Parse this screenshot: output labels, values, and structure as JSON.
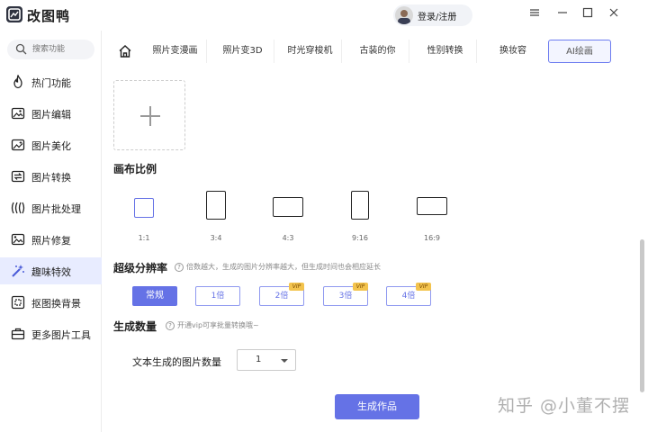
{
  "app": {
    "title": "改图鸭",
    "login_label": "登录/注册"
  },
  "sidebar": {
    "search_placeholder": "搜索功能",
    "items": [
      {
        "label": "热门功能",
        "icon": "flame-icon"
      },
      {
        "label": "图片编辑",
        "icon": "image-edit-icon"
      },
      {
        "label": "图片美化",
        "icon": "image-beautify-icon"
      },
      {
        "label": "图片转换",
        "icon": "image-convert-icon"
      },
      {
        "label": "图片批处理",
        "icon": "batch-icon"
      },
      {
        "label": "照片修复",
        "icon": "photo-repair-icon"
      },
      {
        "label": "趣味特效",
        "icon": "magic-wand-icon",
        "active": true
      },
      {
        "label": "抠图换背景",
        "icon": "cutout-icon"
      },
      {
        "label": "更多图片工具",
        "icon": "toolbox-icon"
      }
    ]
  },
  "tabs": [
    "照片变漫画",
    "照片变3D",
    "时光穿梭机",
    "古装的你",
    "性别转换",
    "换妆容",
    "AI绘画"
  ],
  "main": {
    "canvas_ratio_title": "画布比例",
    "ratios": [
      "1:1",
      "3:4",
      "4:3",
      "9:16",
      "16:9"
    ],
    "resolution_title": "超级分辨率",
    "resolution_hint": "倍数越大，生成的图片分辨率越大，但生成时间也会相应延长",
    "resolution_options": [
      {
        "label": "常规",
        "vip": false
      },
      {
        "label": "1倍",
        "vip": false
      },
      {
        "label": "2倍",
        "vip": true
      },
      {
        "label": "3倍",
        "vip": true
      },
      {
        "label": "4倍",
        "vip": true
      }
    ],
    "vip_badge": "VIP",
    "count_title": "生成数量",
    "count_hint": "开通vip可享批量转换哦~",
    "count_label": "文本生成的图片数量",
    "count_value": "1",
    "generate_label": "生成作品"
  },
  "watermark": "知乎 @小董不摆",
  "colors": {
    "accent": "#6572e6",
    "active_nav_bg": "#e8ecff",
    "vip": "#f3c34d"
  }
}
